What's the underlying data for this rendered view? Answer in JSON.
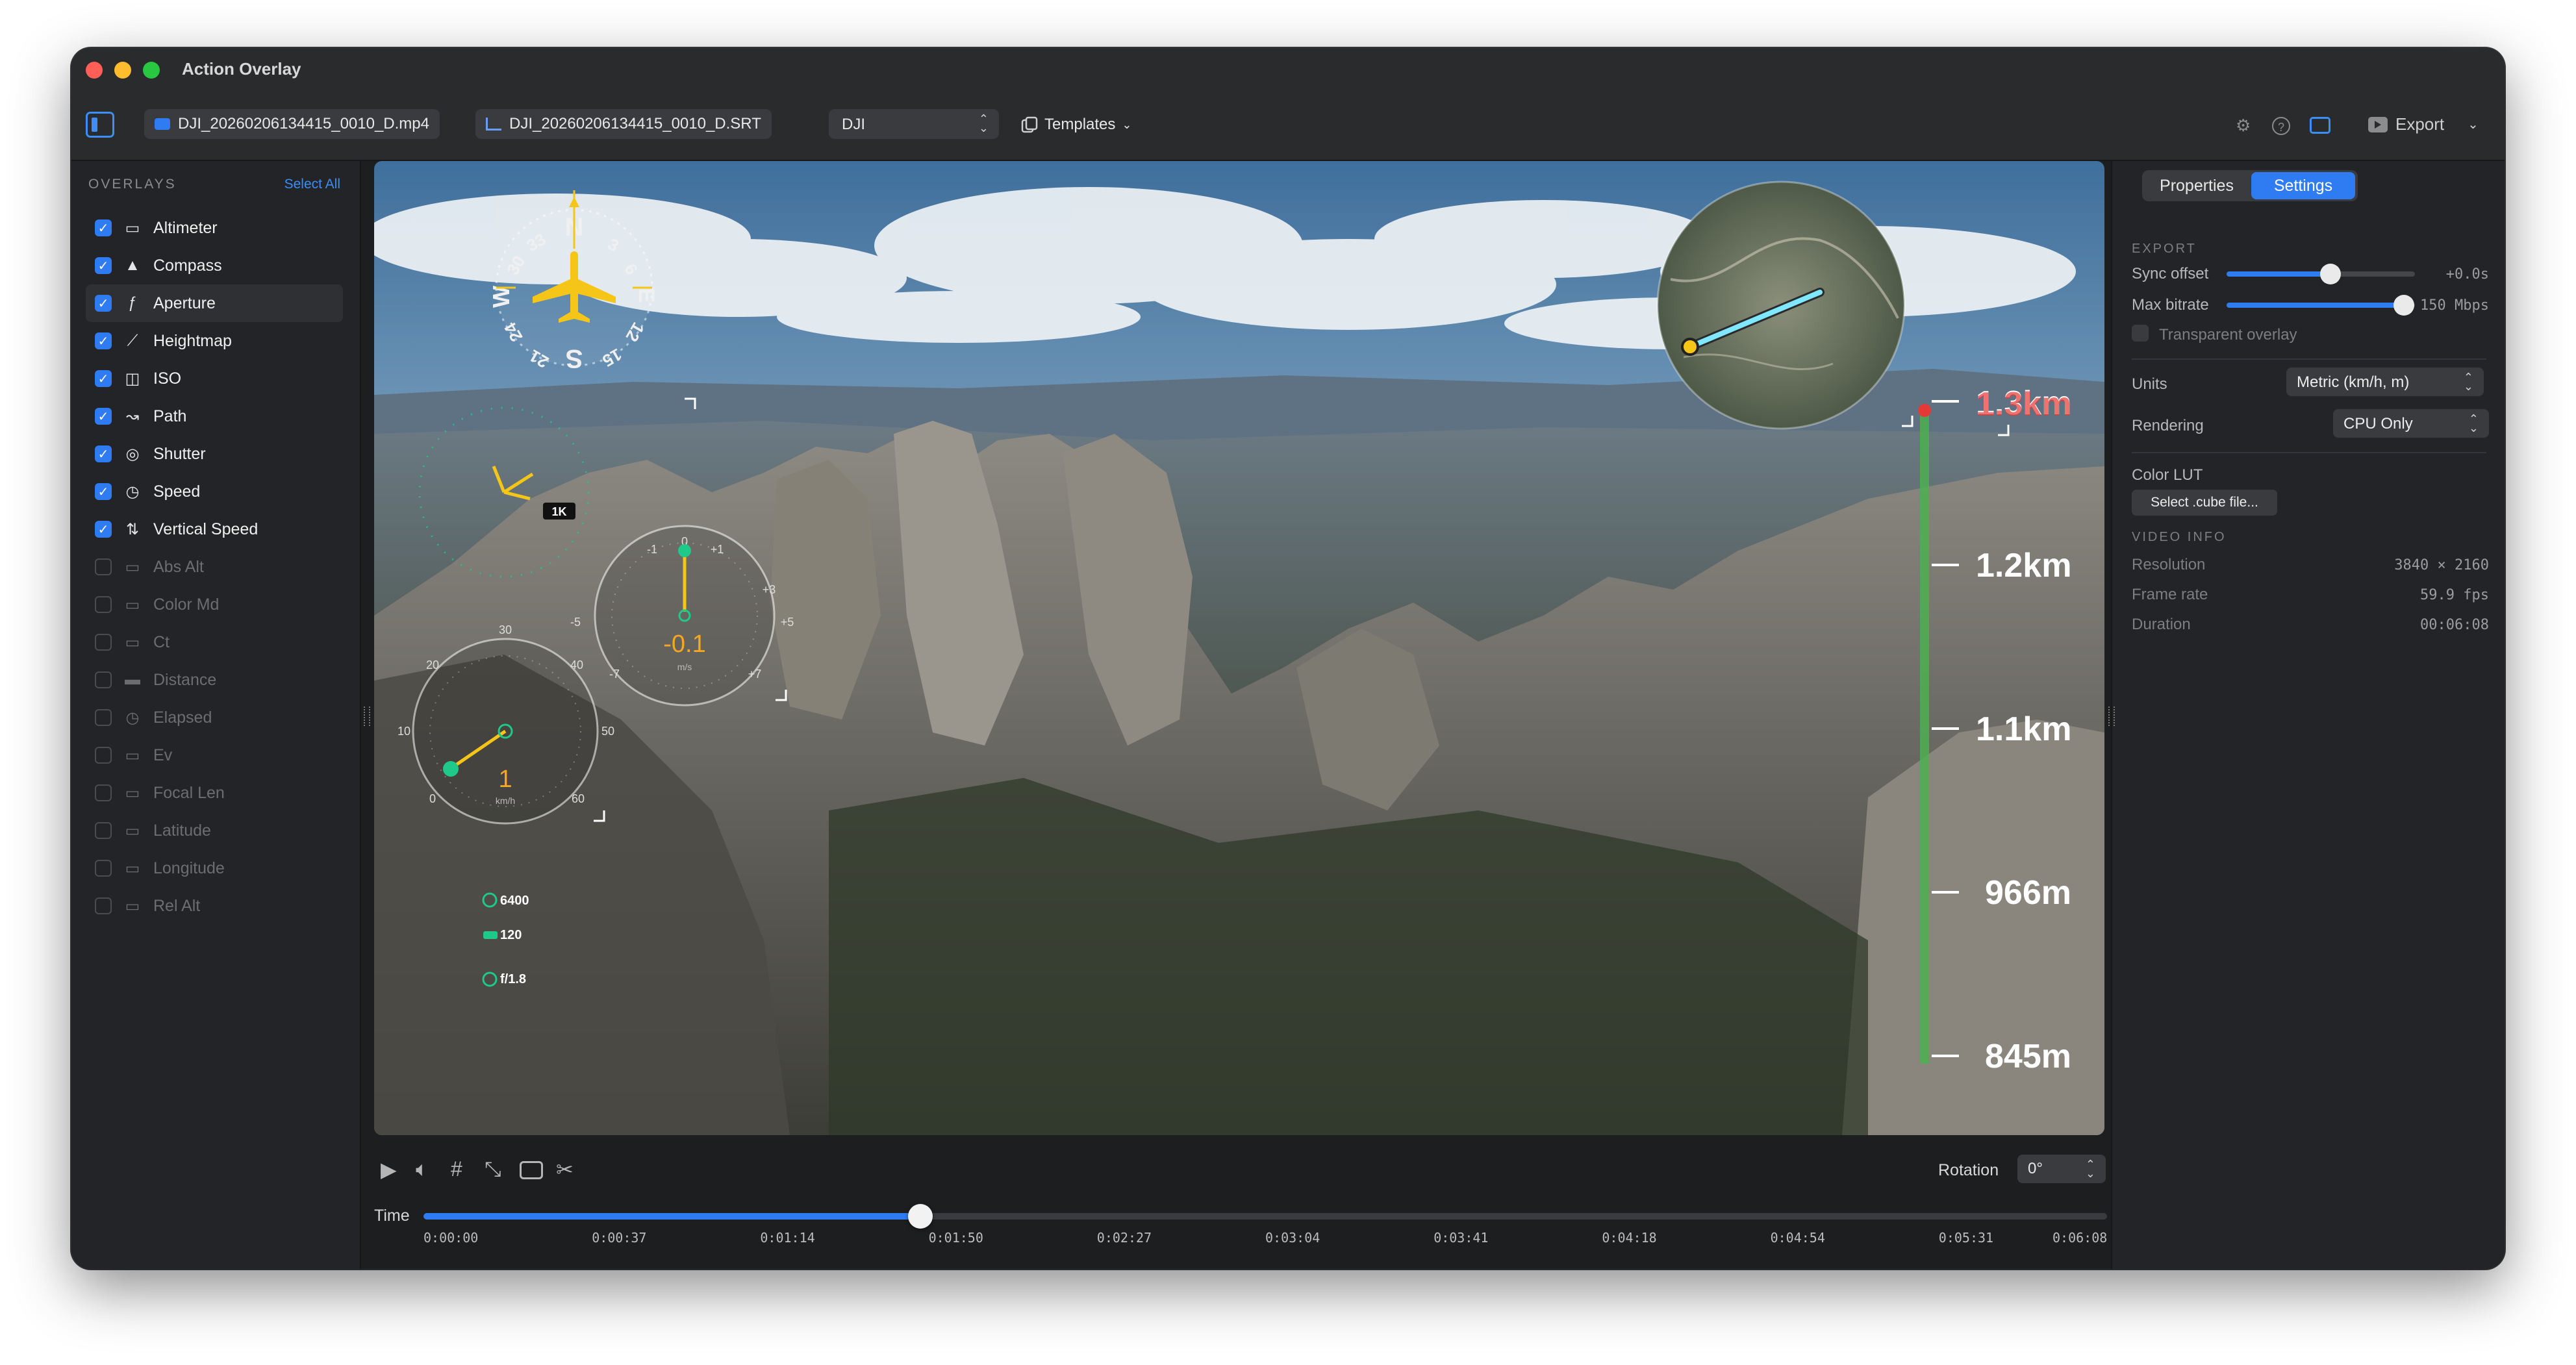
{
  "window": {
    "title": "Action Overlay"
  },
  "toolbar": {
    "video_file": "DJI_20260206134415_0010_D.mp4",
    "srt_file": "DJI_20260206134415_0010_D.SRT",
    "preset": "DJI",
    "templates_label": "Templates",
    "export_label": "Export",
    "icons": [
      "sidebar-icon",
      "video-file-icon",
      "chart-icon",
      "gear-icon",
      "help-icon",
      "panel-icon",
      "export-icon",
      "chevron-down-icon"
    ]
  },
  "sidebar": {
    "heading": "OVERLAYS",
    "select_all": "Select All",
    "items": [
      {
        "label": "Altimeter",
        "checked": true,
        "icon": "altimeter-icon"
      },
      {
        "label": "Compass",
        "checked": true,
        "icon": "compass-icon"
      },
      {
        "label": "Aperture",
        "checked": true,
        "icon": "aperture-icon",
        "selected": true
      },
      {
        "label": "Heightmap",
        "checked": true,
        "icon": "heightmap-icon"
      },
      {
        "label": "ISO",
        "checked": true,
        "icon": "iso-icon"
      },
      {
        "label": "Path",
        "checked": true,
        "icon": "path-icon"
      },
      {
        "label": "Shutter",
        "checked": true,
        "icon": "shutter-icon"
      },
      {
        "label": "Speed",
        "checked": true,
        "icon": "speed-icon"
      },
      {
        "label": "Vertical Speed",
        "checked": true,
        "icon": "vertical-speed-icon"
      },
      {
        "label": "Abs Alt",
        "checked": false,
        "icon": "gauge-icon"
      },
      {
        "label": "Color Md",
        "checked": false,
        "icon": "gauge-icon"
      },
      {
        "label": "Ct",
        "checked": false,
        "icon": "gauge-icon"
      },
      {
        "label": "Distance",
        "checked": false,
        "icon": "distance-icon"
      },
      {
        "label": "Elapsed",
        "checked": false,
        "icon": "clock-icon"
      },
      {
        "label": "Ev",
        "checked": false,
        "icon": "gauge-icon"
      },
      {
        "label": "Focal Len",
        "checked": false,
        "icon": "gauge-icon"
      },
      {
        "label": "Latitude",
        "checked": false,
        "icon": "gauge-icon"
      },
      {
        "label": "Longitude",
        "checked": false,
        "icon": "gauge-icon"
      },
      {
        "label": "Rel Alt",
        "checked": false,
        "icon": "gauge-icon"
      }
    ]
  },
  "video_overlay": {
    "compass_letters": [
      "N",
      "3",
      "6",
      "E",
      "12",
      "15",
      "S",
      "21",
      "24",
      "W",
      "30",
      "33"
    ],
    "altitude_scale": [
      "1.3km",
      "1.2km",
      "1.1km",
      "966m",
      "845m"
    ],
    "vertical_speed": {
      "value": "-0.1",
      "unit": "m/s",
      "ticks": [
        "-1",
        "0",
        "+1",
        "+3",
        "+5",
        "+7",
        "-5",
        "-7"
      ]
    },
    "speed": {
      "value": "1",
      "unit": "km/h",
      "ticks": [
        "0",
        "10",
        "20",
        "30",
        "40",
        "50",
        "60"
      ]
    },
    "heightmap_badge": "1K",
    "iso": "6400",
    "shutter": "120",
    "aperture": "f/1.8",
    "colors": {
      "accent": "#f5c518",
      "gauge": "#1ec98a",
      "altitude_bar": "#4caf50",
      "marker": "#e53935"
    }
  },
  "playback": {
    "rotation_label": "Rotation",
    "rotation_value": "0°",
    "time_label": "Time",
    "progress": 0.295,
    "ticks": [
      "0:00:00",
      "0:00:37",
      "0:01:14",
      "0:01:50",
      "0:02:27",
      "0:03:04",
      "0:03:41",
      "0:04:18",
      "0:04:54",
      "0:05:31",
      "0:06:08"
    ]
  },
  "inspector": {
    "tabs": [
      {
        "label": "Properties",
        "active": false
      },
      {
        "label": "Settings",
        "active": true
      }
    ],
    "export_heading": "EXPORT",
    "sync_offset": {
      "label": "Sync offset",
      "value": "+0.0s",
      "level": 0.55
    },
    "max_bitrate": {
      "label": "Max bitrate",
      "value": "150 Mbps",
      "level": 0.94
    },
    "transparent_overlay": {
      "label": "Transparent overlay",
      "checked": false
    },
    "units": {
      "label": "Units",
      "value": "Metric (km/h, m)"
    },
    "rendering": {
      "label": "Rendering",
      "value": "CPU Only"
    },
    "color_lut": {
      "label": "Color LUT",
      "button": "Select .cube file..."
    },
    "video_info_heading": "VIDEO INFO",
    "resolution": {
      "label": "Resolution",
      "value": "3840 × 2160"
    },
    "frame_rate": {
      "label": "Frame rate",
      "value": "59.9 fps"
    },
    "duration": {
      "label": "Duration",
      "value": "00:06:08"
    }
  }
}
